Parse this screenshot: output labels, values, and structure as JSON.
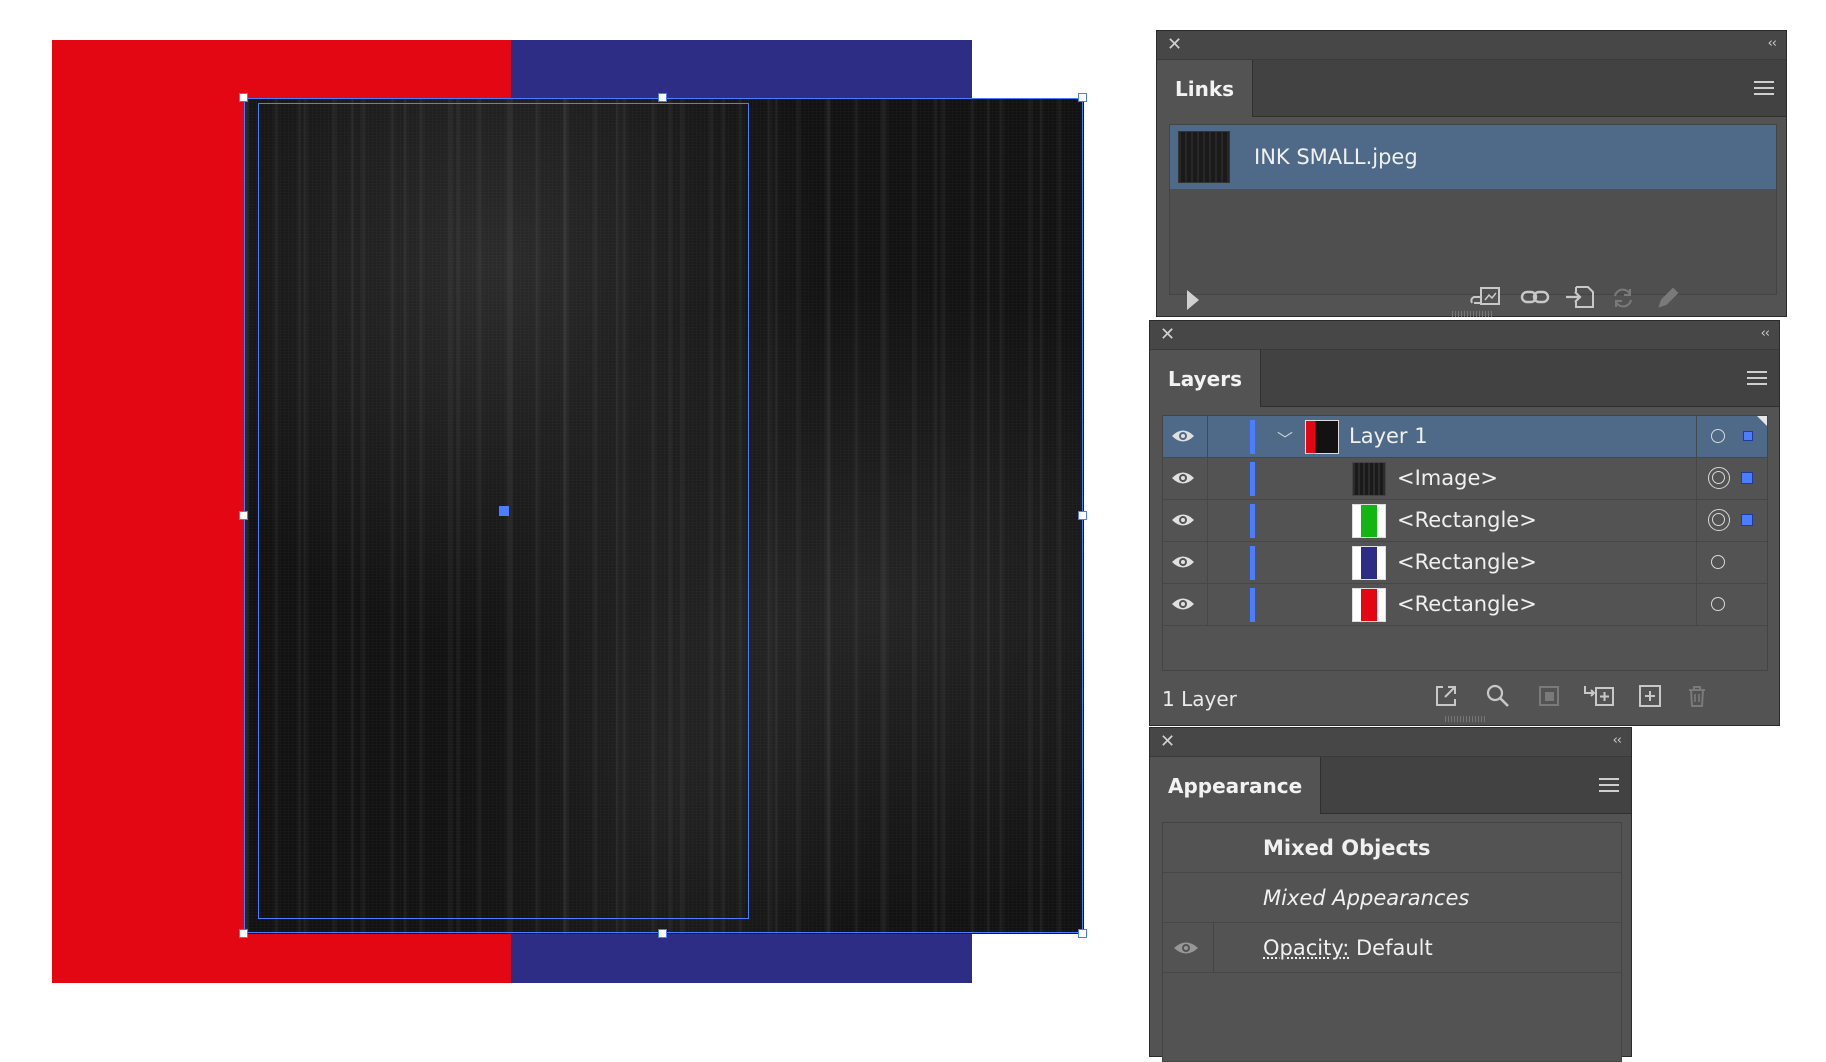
{
  "canvas": {
    "colors": {
      "red": "#e30613",
      "blue": "#2e2d86",
      "selection": "#4a7dff"
    },
    "image_name": "INK SMALL.jpeg"
  },
  "links_panel": {
    "tab_label": "Links",
    "items": [
      {
        "name": "INK SMALL.jpeg",
        "selected": true
      }
    ],
    "footer_icons": [
      "show-more-icon",
      "relink-from-cc-icon",
      "relink-icon",
      "embed-icon",
      "update-link-icon",
      "edit-original-icon"
    ]
  },
  "layers_panel": {
    "tab_label": "Layers",
    "rows": [
      {
        "name": "Layer 1",
        "thumb": "layer-thumb",
        "selected": true,
        "expanded": true
      },
      {
        "name": "<Image>",
        "thumb": "image-thumb"
      },
      {
        "name": "<Rectangle>",
        "thumb": "green-rect-thumb"
      },
      {
        "name": "<Rectangle>",
        "thumb": "blue-rect-thumb"
      },
      {
        "name": "<Rectangle>",
        "thumb": "red-rect-thumb"
      }
    ],
    "footer_count": "1 Layer",
    "footer_icons": [
      "export-icon",
      "locate-object-icon",
      "clipping-mask-icon",
      "new-sublayer-icon",
      "new-layer-icon",
      "delete-icon"
    ]
  },
  "appearance_panel": {
    "tab_label": "Appearance",
    "title": "Mixed Objects",
    "subtitle": "Mixed Appearances",
    "opacity_label": "Opacity:",
    "opacity_value": "Default"
  }
}
